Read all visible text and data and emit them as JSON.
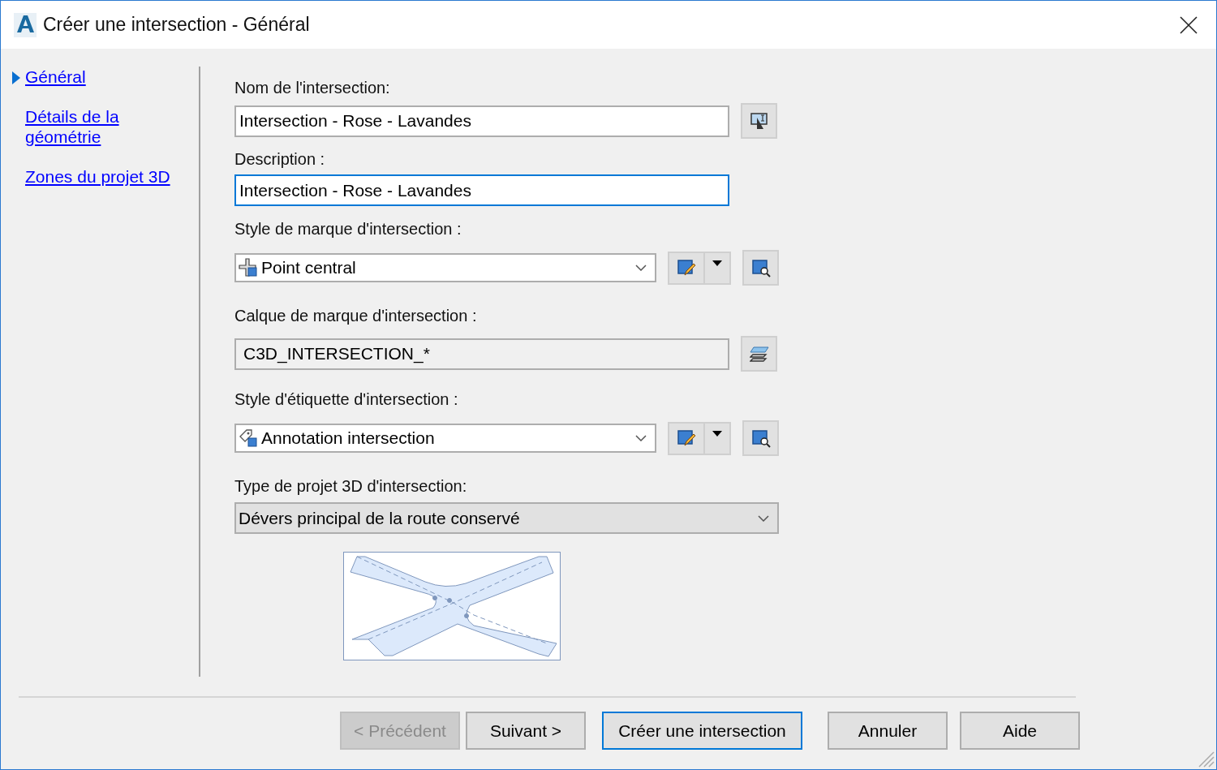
{
  "window": {
    "title": "Créer une intersection - Général"
  },
  "sidebar": {
    "items": [
      {
        "label": "Général",
        "selected": true
      },
      {
        "label": "Détails de la géométrie",
        "selected": false
      },
      {
        "label": "Zones du projet 3D",
        "selected": false
      }
    ]
  },
  "fields": [
    {
      "kind": "text",
      "label": "Nom de l'intersection:",
      "value": "Intersection - Rose - Lavandes",
      "focused": false
    },
    {
      "kind": "text",
      "label": "Description :",
      "value": "Intersection - Rose - Lavandes",
      "focused": true
    },
    {
      "kind": "combo",
      "label": "Style de marque d'intersection :",
      "value": "Point central"
    },
    {
      "kind": "readonly",
      "label": "Calque de marque d'intersection :",
      "value": "C3D_INTERSECTION_*"
    },
    {
      "kind": "combo",
      "label": "Style d'étiquette d'intersection :",
      "value": "Annotation intersection"
    },
    {
      "kind": "dropdown",
      "label": "Type de projet 3D d'intersection:",
      "value": "Dévers principal de la route conservé"
    }
  ],
  "buttons": [
    {
      "label": "< Précédent",
      "disabled": true,
      "default": false
    },
    {
      "label": "Suivant >",
      "disabled": false,
      "default": false
    },
    {
      "label": "Créer une intersection",
      "disabled": false,
      "default": true
    },
    {
      "label": "Annuler",
      "disabled": false,
      "default": false
    },
    {
      "label": "Aide",
      "disabled": false,
      "default": false
    }
  ]
}
